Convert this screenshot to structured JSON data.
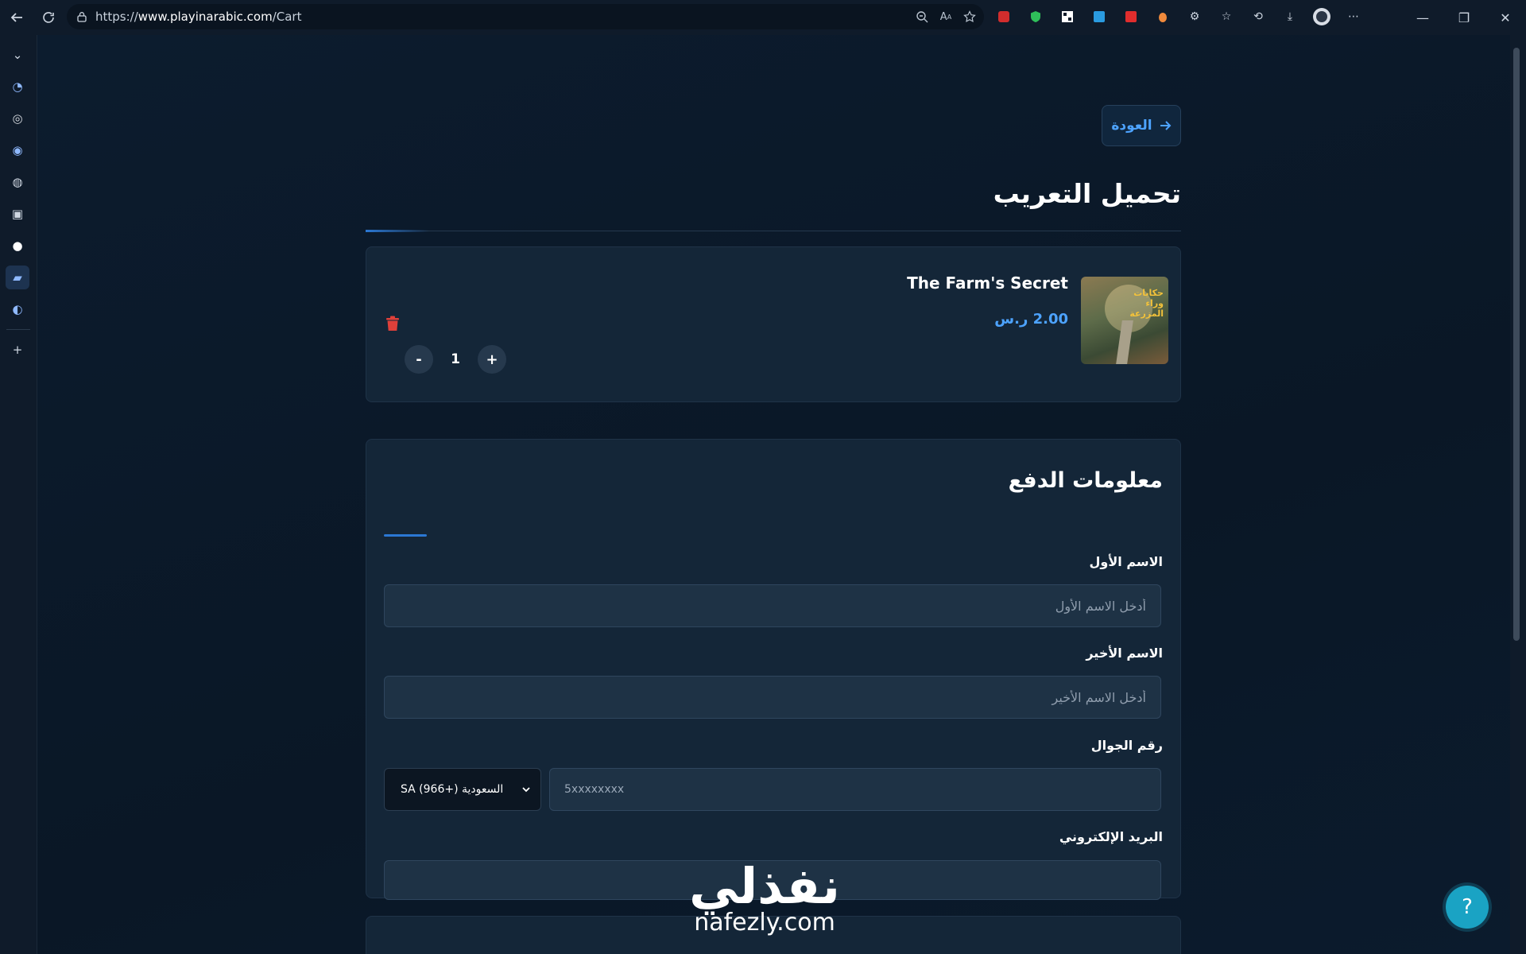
{
  "browser": {
    "url_prefix": "https://",
    "url_host": "www.playinarabic.com",
    "url_path": "/Cart"
  },
  "page": {
    "back_label": "العودة",
    "title": "تحميل التعريب"
  },
  "cart": {
    "items": [
      {
        "name": "The Farm's Secret",
        "price": "2.00 ر.س",
        "quantity": "1",
        "thumb_text": "حكايات وراء المزرعة"
      }
    ],
    "minus_label": "-",
    "plus_label": "+"
  },
  "payment": {
    "title": "معلومات الدفع",
    "first_name_label": "الاسم الأول",
    "first_name_placeholder": "أدخل الاسم الأول",
    "last_name_label": "الاسم الأخير",
    "last_name_placeholder": "أدخل الاسم الأخير",
    "phone_label": "رقم الجوال",
    "phone_placeholder": "5xxxxxxxx",
    "country_selected": "SA (966+) السعودية",
    "email_label": "البريد الإلكتروني",
    "email_value": ""
  },
  "watermark": {
    "arabic": "نفذلي",
    "latin": "nafezly.com"
  },
  "help": {
    "label": "?"
  },
  "colors": {
    "accent": "#4da3ff",
    "background": "#0b1a2b",
    "card": "#142638",
    "help_button": "#1aa3c4",
    "delete": "#e0403a"
  }
}
